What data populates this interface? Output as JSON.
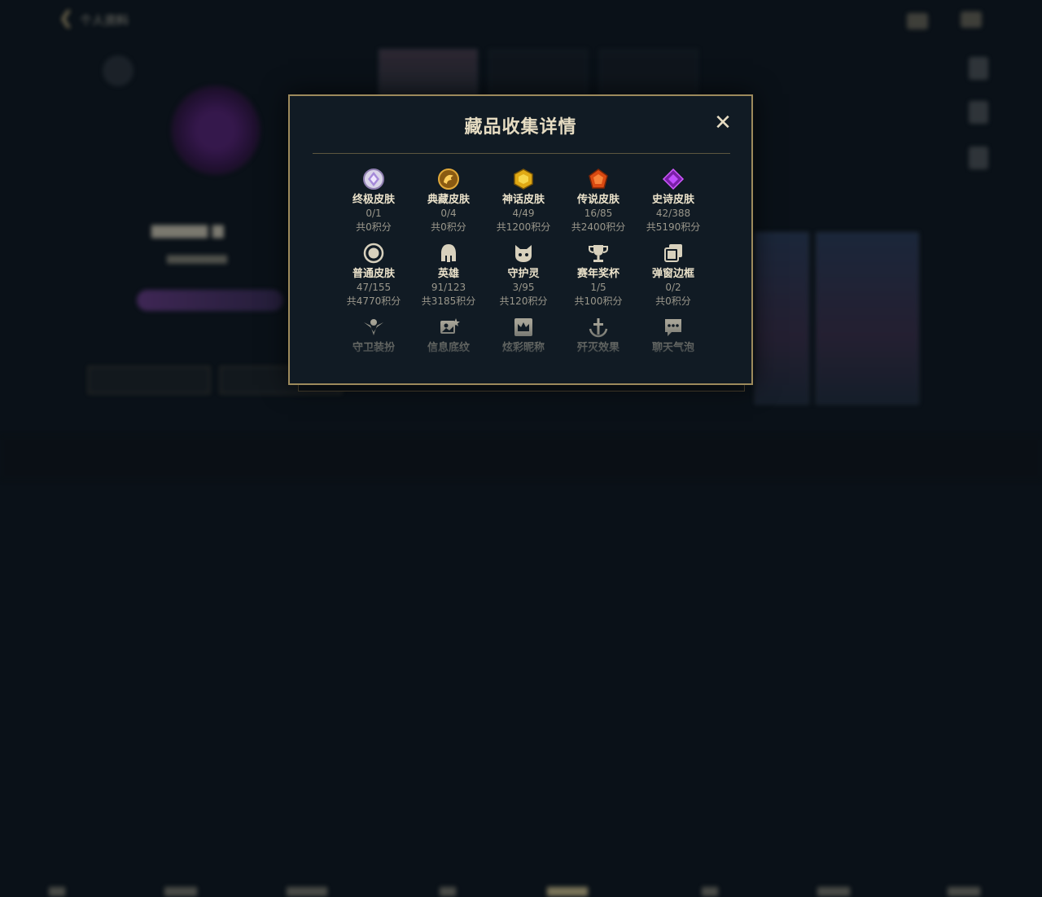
{
  "background": {
    "header_title": "个人资料",
    "tabs": [
      "",
      "",
      "",
      "",
      "",
      "",
      "",
      "",
      ""
    ]
  },
  "modal": {
    "title": "藏品收集详情",
    "close_symbol": "✕",
    "items": [
      {
        "label": "终极皮肤",
        "count": "0/1",
        "points": "共0积分",
        "icon": "ultimate-skin-icon"
      },
      {
        "label": "典藏皮肤",
        "count": "0/4",
        "points": "共0积分",
        "icon": "collection-skin-icon"
      },
      {
        "label": "神话皮肤",
        "count": "4/49",
        "points": "共1200积分",
        "icon": "mythic-skin-icon"
      },
      {
        "label": "传说皮肤",
        "count": "16/85",
        "points": "共2400积分",
        "icon": "legendary-skin-icon"
      },
      {
        "label": "史诗皮肤",
        "count": "42/388",
        "points": "共5190积分",
        "icon": "epic-skin-icon"
      },
      {
        "label": "普通皮肤",
        "count": "47/155",
        "points": "共4770积分",
        "icon": "normal-skin-icon"
      },
      {
        "label": "英雄",
        "count": "91/123",
        "points": "共3185积分",
        "icon": "hero-helmet-icon"
      },
      {
        "label": "守护灵",
        "count": "3/95",
        "points": "共120积分",
        "icon": "guardian-spirit-icon"
      },
      {
        "label": "赛年奖杯",
        "count": "1/5",
        "points": "共100积分",
        "icon": "trophy-icon"
      },
      {
        "label": "弹窗边框",
        "count": "0/2",
        "points": "共0积分",
        "icon": "popup-frame-icon"
      },
      {
        "label": "守卫装扮",
        "count": "",
        "points": "",
        "icon": "ward-skin-icon"
      },
      {
        "label": "信息底纹",
        "count": "",
        "points": "",
        "icon": "info-pattern-icon"
      },
      {
        "label": "炫彩昵称",
        "count": "",
        "points": "",
        "icon": "colorful-nickname-icon"
      },
      {
        "label": "歼灭效果",
        "count": "",
        "points": "",
        "icon": "annihilation-effect-icon"
      },
      {
        "label": "聊天气泡",
        "count": "",
        "points": "",
        "icon": "chat-bubble-icon"
      }
    ]
  },
  "colors": {
    "modal_border": "#9d8a5c",
    "modal_bg": "#111b24",
    "label": "#ece3cb",
    "muted": "#9a978b"
  }
}
